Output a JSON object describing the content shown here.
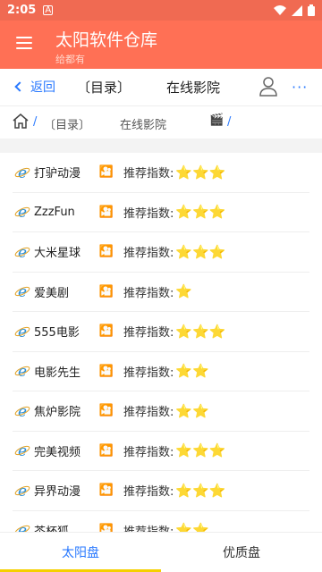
{
  "status": {
    "time": "2:05",
    "notif_glyph": "A"
  },
  "appbar": {
    "title": "太阳软件仓库",
    "subtitle": "给都有"
  },
  "navbar": {
    "back_label": "返回",
    "catalog_label": "〔目录〕",
    "page_title": "在线影院",
    "more_label": "···"
  },
  "breadcrumb": {
    "sep": "/",
    "items": [
      "〔目录〕",
      "在线影院",
      "🎬"
    ]
  },
  "list_label": "推荐指数:",
  "items": [
    {
      "name": "打驴动漫",
      "stars": "⭐⭐⭐"
    },
    {
      "name": "ZzzFun",
      "stars": "⭐⭐⭐"
    },
    {
      "name": "大米星球",
      "stars": "⭐⭐⭐"
    },
    {
      "name": "爱美剧",
      "stars": "⭐"
    },
    {
      "name": "555电影",
      "stars": "⭐⭐⭐"
    },
    {
      "name": "电影先生",
      "stars": "⭐⭐"
    },
    {
      "name": "焦炉影院",
      "stars": "⭐⭐"
    },
    {
      "name": "完美视频",
      "stars": "⭐⭐⭐"
    },
    {
      "name": "异界动漫",
      "stars": "⭐⭐⭐"
    },
    {
      "name": "茶杯狐",
      "stars": "⭐⭐"
    }
  ],
  "film_icon": "🎦",
  "tabs": [
    "太阳盘",
    "优质盘"
  ],
  "colors": {
    "accent": "#ff7055",
    "link": "#2979ff",
    "star": "#f5c518",
    "tab_indicator": "#f5d000"
  }
}
